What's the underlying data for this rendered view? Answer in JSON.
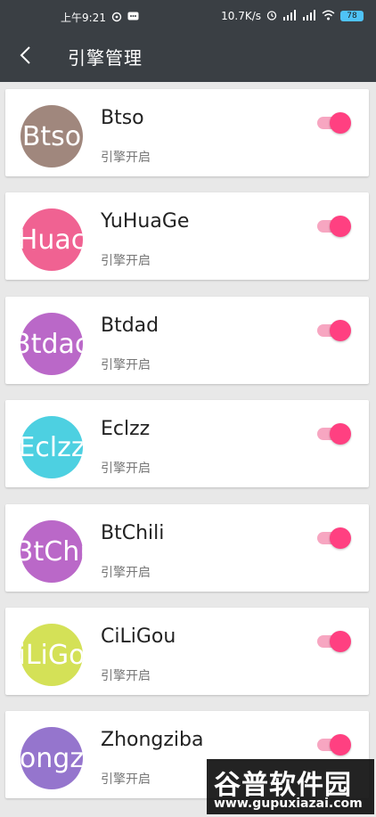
{
  "status_bar": {
    "time": "上午9:21",
    "network_speed": "10.7K/s",
    "battery": "78",
    "icons": [
      "weibo-icon",
      "message-icon",
      "alarm-icon",
      "signal-icon",
      "signal-icon",
      "wifi-icon",
      "battery-icon"
    ]
  },
  "header": {
    "back_icon": "chevron-left-icon",
    "title": "引擎管理"
  },
  "colors": {
    "app_bar": "#3a3f44",
    "switch_on": "#ff4081",
    "switch_track": "#f7a6c1"
  },
  "engines": [
    {
      "name": "Btso",
      "avatar_text": "Btso",
      "status": "引擎开启",
      "enabled": true,
      "avatar_color": "#a0877d"
    },
    {
      "name": "YuHuaGe",
      "avatar_text": "Huac",
      "status": "引擎开启",
      "enabled": true,
      "avatar_color": "#f06292"
    },
    {
      "name": "Btdad",
      "avatar_text": "3tdac",
      "status": "引擎开启",
      "enabled": true,
      "avatar_color": "#ba68c8"
    },
    {
      "name": "Eclzz",
      "avatar_text": "Eclzz",
      "status": "引擎开启",
      "enabled": true,
      "avatar_color": "#4dd0e1"
    },
    {
      "name": "BtChili",
      "avatar_text": "3tChi",
      "status": "引擎开启",
      "enabled": true,
      "avatar_color": "#ba68c8"
    },
    {
      "name": "CiLiGou",
      "avatar_text": "iLiGo",
      "status": "引擎开启",
      "enabled": true,
      "avatar_color": "#d4e157"
    },
    {
      "name": "Zhongziba",
      "avatar_text": "ongz",
      "status": "引擎开启",
      "enabled": true,
      "avatar_color": "#9575cd"
    }
  ],
  "watermark": {
    "text": "谷普软件园",
    "url": "www.gupuxiazai.com"
  }
}
